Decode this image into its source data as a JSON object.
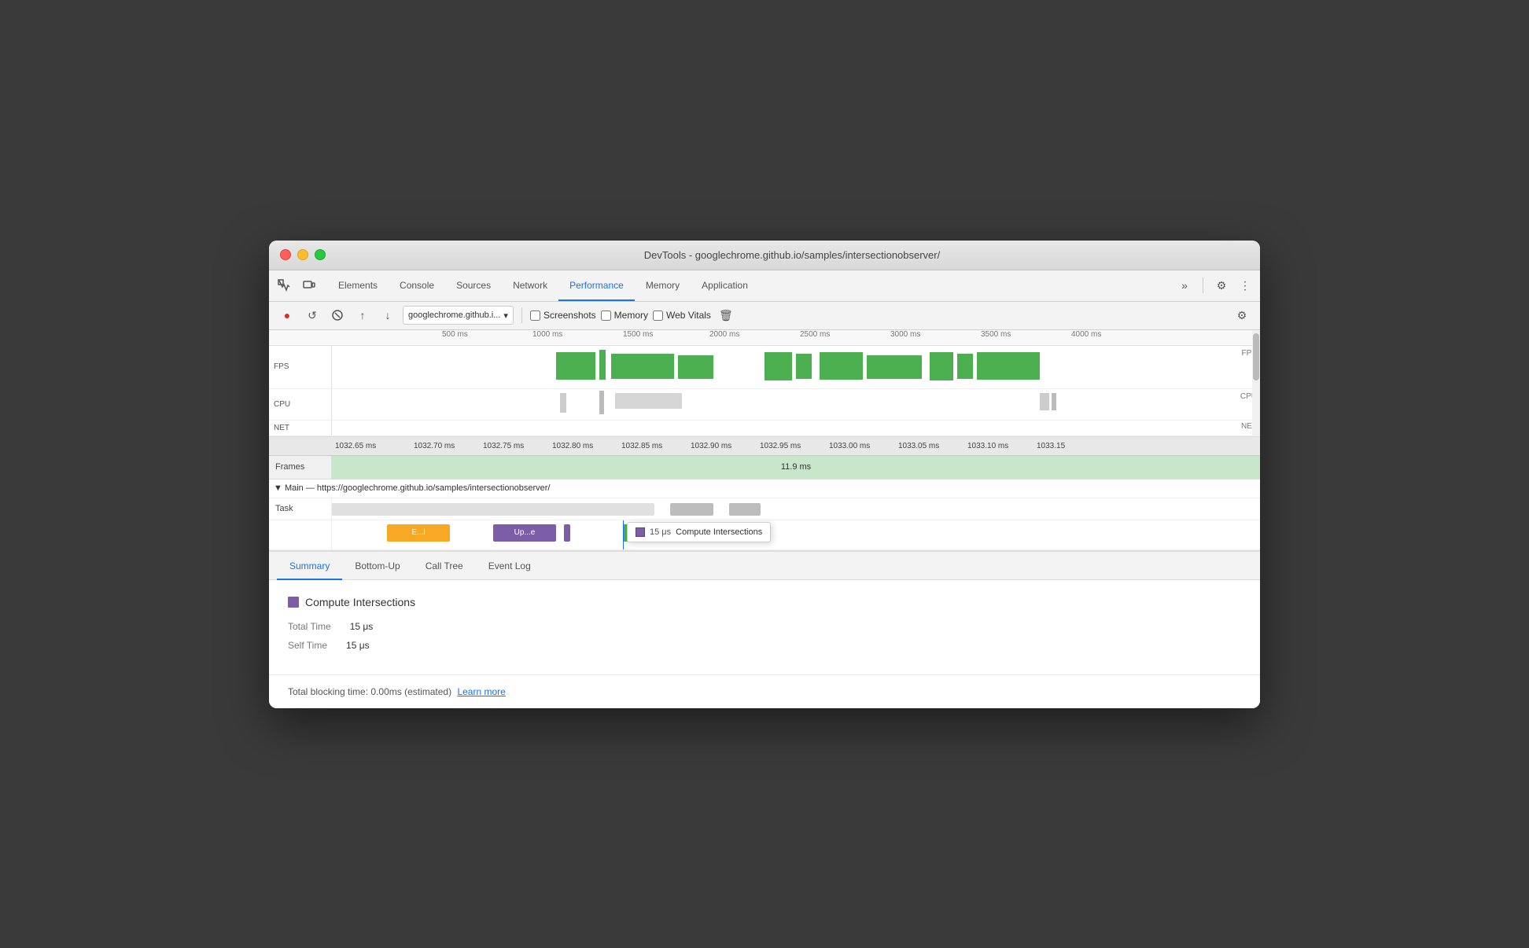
{
  "window": {
    "title": "DevTools - googlechrome.github.io/samples/intersectionobserver/"
  },
  "tabs": {
    "items": [
      {
        "id": "elements",
        "label": "Elements",
        "active": false
      },
      {
        "id": "console",
        "label": "Console",
        "active": false
      },
      {
        "id": "sources",
        "label": "Sources",
        "active": false
      },
      {
        "id": "network",
        "label": "Network",
        "active": false
      },
      {
        "id": "performance",
        "label": "Performance",
        "active": true
      },
      {
        "id": "memory",
        "label": "Memory",
        "active": false
      },
      {
        "id": "application",
        "label": "Application",
        "active": false
      }
    ]
  },
  "toolbar": {
    "record_label": "●",
    "reload_label": "↺",
    "clear_label": "⊘",
    "upload_label": "↑",
    "download_label": "↓",
    "url_text": "googlechrome.github.i...",
    "screenshots_label": "Screenshots",
    "memory_label": "Memory",
    "web_vitals_label": "Web Vitals",
    "delete_label": "🗑",
    "settings_label": "⚙"
  },
  "timeline": {
    "ticks": [
      {
        "label": "500 ms",
        "offset": 100
      },
      {
        "label": "1000 ms",
        "offset": 210
      },
      {
        "label": "1500 ms",
        "offset": 325
      },
      {
        "label": "2000 ms",
        "offset": 440
      },
      {
        "label": "2500 ms",
        "offset": 555
      },
      {
        "label": "3000 ms",
        "offset": 670
      },
      {
        "label": "3500 ms",
        "offset": 790
      },
      {
        "label": "4000 ms",
        "offset": 905
      }
    ],
    "fps_label": "FPS",
    "cpu_label": "CPU",
    "net_label": "NET"
  },
  "zoomed": {
    "ticks": [
      "1032.65 ms",
      "1032.70 ms",
      "1032.75 ms",
      "1032.80 ms",
      "1032.85 ms",
      "1032.90 ms",
      "1032.95 ms",
      "1033.00 ms",
      "1033.05 ms",
      "1033.10 ms",
      "1033.15"
    ],
    "frames_label": "Frames",
    "frame_duration": "11.9 ms",
    "main_thread_label": "▼ Main — https://googlechrome.github.io/samples/intersectionobserver/",
    "task_label": "Task"
  },
  "tooltip": {
    "time": "15 μs",
    "label": "Compute Intersections"
  },
  "bottom_tabs": [
    {
      "id": "summary",
      "label": "Summary",
      "active": true
    },
    {
      "id": "bottom-up",
      "label": "Bottom-Up",
      "active": false
    },
    {
      "id": "call-tree",
      "label": "Call Tree",
      "active": false
    },
    {
      "id": "event-log",
      "label": "Event Log",
      "active": false
    }
  ],
  "summary": {
    "title": "Compute Intersections",
    "total_time_label": "Total Time",
    "total_time_value": "15 μs",
    "self_time_label": "Self Time",
    "self_time_value": "15 μs",
    "blocking_text": "Total blocking time: 0.00ms (estimated)",
    "learn_more_label": "Learn more"
  }
}
